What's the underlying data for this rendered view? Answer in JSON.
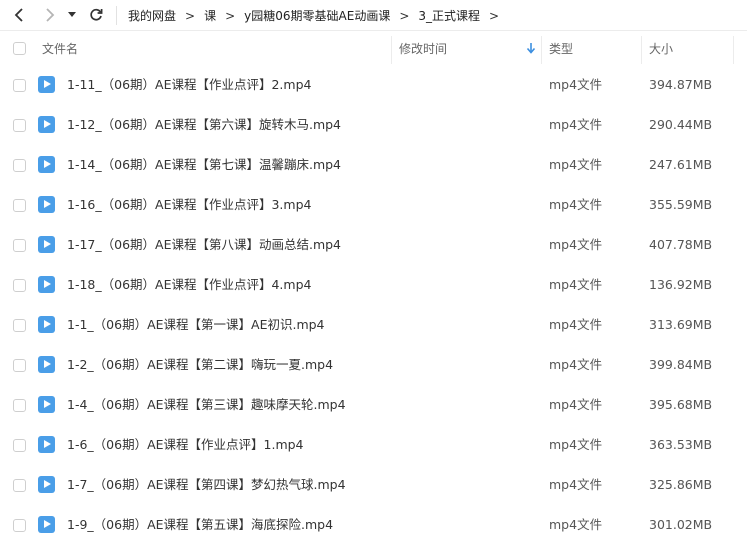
{
  "breadcrumb": [
    "我的网盘",
    "课",
    "y园糖06期零基础AE动画课",
    "3_正式课程"
  ],
  "header": {
    "name": "文件名",
    "modified": "修改时间",
    "type": "类型",
    "size": "大小"
  },
  "colors": {
    "accent": "#4a9ee8"
  },
  "files": [
    {
      "name": "1-11_（06期）AE课程【作业点评】2.mp4",
      "type": "mp4文件",
      "size": "394.87MB"
    },
    {
      "name": "1-12_（06期）AE课程【第六课】旋转木马.mp4",
      "type": "mp4文件",
      "size": "290.44MB"
    },
    {
      "name": "1-14_（06期）AE课程【第七课】温馨蹦床.mp4",
      "type": "mp4文件",
      "size": "247.61MB"
    },
    {
      "name": "1-16_（06期）AE课程【作业点评】3.mp4",
      "type": "mp4文件",
      "size": "355.59MB"
    },
    {
      "name": "1-17_（06期）AE课程【第八课】动画总结.mp4",
      "type": "mp4文件",
      "size": "407.78MB"
    },
    {
      "name": "1-18_（06期）AE课程【作业点评】4.mp4",
      "type": "mp4文件",
      "size": "136.92MB"
    },
    {
      "name": "1-1_（06期）AE课程【第一课】AE初识.mp4",
      "type": "mp4文件",
      "size": "313.69MB"
    },
    {
      "name": "1-2_（06期）AE课程【第二课】嗨玩一夏.mp4",
      "type": "mp4文件",
      "size": "399.84MB"
    },
    {
      "name": "1-4_（06期）AE课程【第三课】趣味摩天轮.mp4",
      "type": "mp4文件",
      "size": "395.68MB"
    },
    {
      "name": "1-6_（06期）AE课程【作业点评】1.mp4",
      "type": "mp4文件",
      "size": "363.53MB"
    },
    {
      "name": "1-7_（06期）AE课程【第四课】梦幻热气球.mp4",
      "type": "mp4文件",
      "size": "325.86MB"
    },
    {
      "name": "1-9_（06期）AE课程【第五课】海底探险.mp4",
      "type": "mp4文件",
      "size": "301.02MB"
    }
  ]
}
